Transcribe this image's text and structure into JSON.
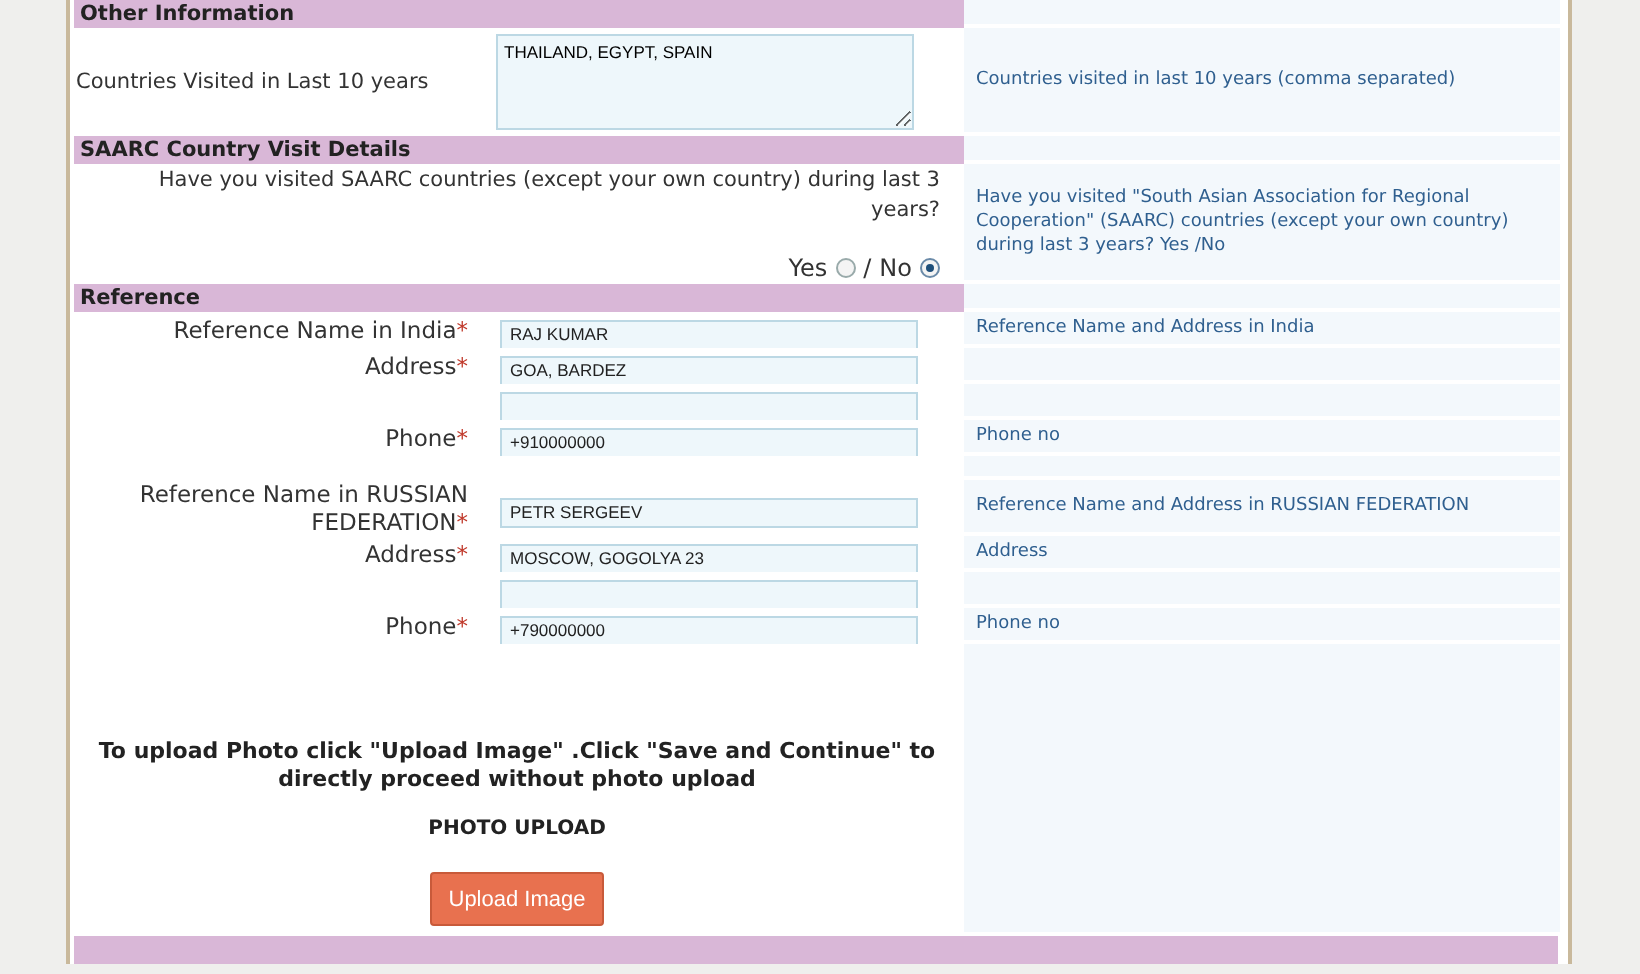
{
  "sections": [
    {
      "title": "Other Information",
      "rows": [
        {
          "kind": "textarea",
          "label": "Countries Visited in Last 10 years",
          "value": "THAILAND, EGYPT, SPAIN",
          "help": "Countries visited in last 10 years (comma separated)"
        }
      ]
    },
    {
      "title": "SAARC Country Visit Details",
      "rows": [
        {
          "kind": "question",
          "text": "Have you visited SAARC countries (except your own country) during last 3 years?",
          "separator": "/",
          "options": [
            {
              "label": "Yes",
              "selected": false
            },
            {
              "label": "No",
              "selected": true
            }
          ],
          "help": "Have you visited \"South Asian Association for Regional Cooperation\" (SAARC) countries (except your own country) during last 3 years? Yes /No"
        }
      ]
    },
    {
      "title": "Reference",
      "groups": [
        [
          {
            "kind": "field",
            "label": "Reference Name in India",
            "mark": "*",
            "value": "RAJ KUMAR",
            "help": "Reference Name and Address in India"
          },
          {
            "kind": "field",
            "label": "Address",
            "mark": "*",
            "value": "GOA, BARDEZ"
          },
          {
            "kind": "field"
          },
          {
            "kind": "field",
            "label": "Phone",
            "mark": "*",
            "value": "+910000000",
            "help": "Phone no"
          }
        ],
        [
          {
            "kind": "field",
            "label": "Reference Name in RUSSIAN FEDERATION",
            "mark": "*",
            "value": "PETR SERGEEV",
            "help": "Reference Name and Address in RUSSIAN FEDERATION"
          },
          {
            "kind": "field",
            "label": "Address",
            "mark": "*",
            "value": "MOSCOW, GOGOLYA 23",
            "help": "Address"
          },
          {
            "kind": "field"
          },
          {
            "kind": "field",
            "label": "Phone",
            "mark": "*",
            "value": "+790000000",
            "help": "Phone no"
          }
        ]
      ]
    }
  ],
  "upload": {
    "instruction": "To upload Photo click \"Upload Image\" .Click \"Save and Continue\" to directly proceed without photo upload",
    "heading": "PHOTO UPLOAD",
    "button": "Upload Image"
  }
}
